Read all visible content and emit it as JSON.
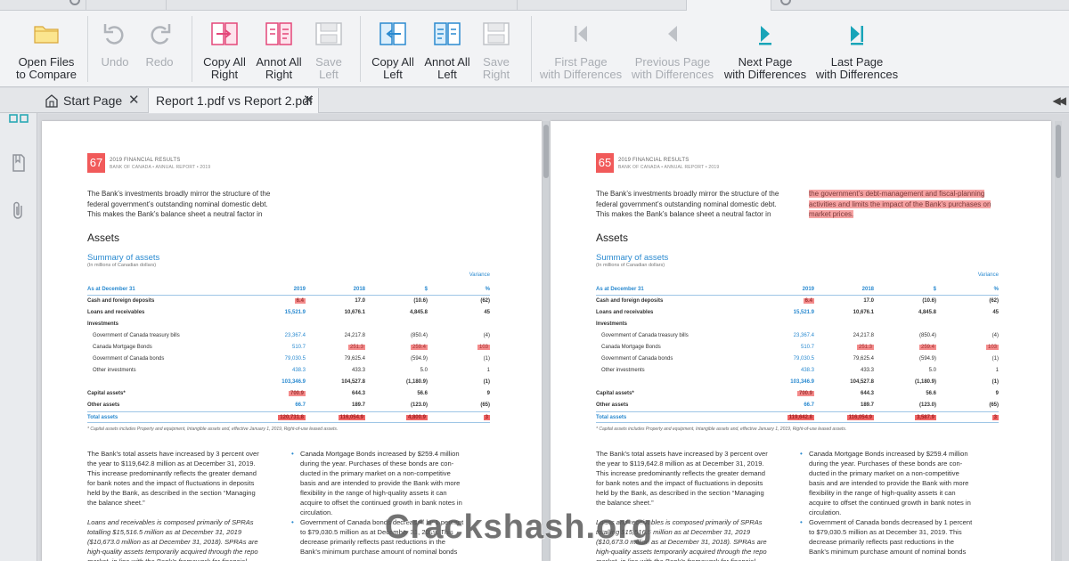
{
  "ribbon": {
    "buttons": [
      {
        "label": "Open Files\nto Compare",
        "icon": "folder-icon",
        "enabled": true
      },
      {
        "label": "Undo",
        "icon": "undo-icon",
        "enabled": false
      },
      {
        "label": "Redo",
        "icon": "redo-icon",
        "enabled": false
      },
      {
        "label": "Copy All\nRight",
        "icon": "copy-all-right-icon",
        "enabled": true
      },
      {
        "label": "Annot All\nRight",
        "icon": "annot-all-right-icon",
        "enabled": true
      },
      {
        "label": "Save\nLeft",
        "icon": "save-left-icon",
        "enabled": false
      },
      {
        "label": "Copy All\nLeft",
        "icon": "copy-all-left-icon",
        "enabled": true
      },
      {
        "label": "Annot All\nLeft",
        "icon": "annot-all-left-icon",
        "enabled": true
      },
      {
        "label": "Save\nRight",
        "icon": "save-right-icon",
        "enabled": false
      },
      {
        "label": "First Page\nwith Differences",
        "icon": "first-page-icon",
        "enabled": false
      },
      {
        "label": "Previous Page\nwith Differences",
        "icon": "previous-page-icon",
        "enabled": false
      },
      {
        "label": "Next Page\nwith Differences",
        "icon": "next-page-icon",
        "enabled": true
      },
      {
        "label": "Last Page\nwith Differences",
        "icon": "last-page-icon",
        "enabled": true
      }
    ]
  },
  "tabs": [
    {
      "label": "Start Page",
      "icon": "home-icon",
      "close": "✕"
    },
    {
      "label": "Report 1.pdf vs Report 2.pdf",
      "close": "✕"
    }
  ],
  "sidebar": {
    "icons": [
      "thumbnails-icon",
      "bookmark-icon",
      "attachment-icon"
    ]
  },
  "colors": {
    "accent_red": "#f15a5a",
    "diff_highlight": "#f48b8b",
    "link_blue": "#2a8ad0",
    "teal": "#18a4b8"
  },
  "pages": {
    "left": {
      "page_number": "67",
      "header_title": "2019 FINANCIAL RESULTS",
      "header_sub": "BANK OF CANADA • ANNUAL REPORT • 2019",
      "intro": [
        "The Bank’s investments broadly mirror the structure of the",
        "federal government’s outstanding nominal domestic debt.",
        "This makes the Bank’s balance sheet a neutral factor in"
      ],
      "heading": "Assets",
      "summary_title": "Summary of assets",
      "summary_sub": "(In millions of Canadian dollars)",
      "variance_label": "Variance",
      "table_header": [
        "As at December 31",
        "2019",
        "2018",
        "$",
        "%"
      ],
      "rows": [
        {
          "label": "Cash and foreign deposits",
          "v2019": "6.4",
          "v2018": "17.0",
          "d": "(10.6)",
          "p": "(62)",
          "style": "bold"
        },
        {
          "label": "Loans and receivables",
          "v2019": "15,521.9",
          "v2018": "10,676.1",
          "d": "4,845.8",
          "p": "45",
          "style": "bold"
        },
        {
          "label": "Investments",
          "v2019": "",
          "v2018": "",
          "d": "",
          "p": "",
          "style": "bold"
        },
        {
          "label": "Government of Canada treasury bills",
          "v2019": "23,367.4",
          "v2018": "24,217.8",
          "d": "(850.4)",
          "p": "(4)",
          "style": "indent"
        },
        {
          "label": "Canada Mortgage Bonds",
          "v2019": "510.7",
          "v2018": "251.3",
          "d": "259.4",
          "p": "103",
          "style": "indent"
        },
        {
          "label": "Government of Canada bonds",
          "v2019": "79,030.5",
          "v2018": "79,625.4",
          "d": "(594.9)",
          "p": "(1)",
          "style": "indent"
        },
        {
          "label": "Other investments",
          "v2019": "438.3",
          "v2018": "433.3",
          "d": "5.0",
          "p": "1",
          "style": "indent"
        },
        {
          "label": "",
          "v2019": "103,346.9",
          "v2018": "104,527.8",
          "d": "(1,180.9)",
          "p": "(1)",
          "style": "bold"
        },
        {
          "label": "Capital assets*",
          "v2019": "700.9",
          "v2018": "644.3",
          "d": "56.6",
          "p": "9",
          "style": "bold"
        },
        {
          "label": "Other assets",
          "v2019": "66.7",
          "v2018": "189.7",
          "d": "(123.0)",
          "p": "(65)",
          "style": "bold"
        },
        {
          "label": "Total assets",
          "v2019": "120,731.8",
          "v2018": "116,054.9",
          "d": "4,800.9",
          "p": "3",
          "style": "total"
        }
      ],
      "footnote": "* Capital assets includes Property and equipment, Intangible assets and, effective January 1, 2019, Right-of-use leased assets.",
      "body_left": [
        "The Bank’s total assets have increased by 3 percent over",
        "the year to $119,642.8 million as at December 31, 2019.",
        "This increase predominantly reflects the greater demand",
        "for bank notes and the impact of fluctuations in deposits",
        "held by the Bank, as described in the section “Managing",
        "the balance sheet.”",
        "",
        "Loans and receivables is composed primarily of SPRAs",
        "totalling $15,516.5 million as at December 31, 2019",
        "($10,673.0 million as at December 31, 2018). SPRAs are",
        "high-quality assets temporarily acquired through the repo",
        "market, in line with the Bank’s framework for financial"
      ],
      "body_right": [
        "Canada Mortgage Bonds increased by $259.4 million",
        "during the year. Purchases of these bonds are con-",
        "ducted in the primary market on a non-competitive",
        "basis and are intended to provide the Bank with more",
        "flexibility in the range of high-quality assets it can",
        "acquire to offset the continued growth in bank notes in",
        "circulation.",
        "Government of Canada bonds decreased by 1 percent",
        "to $79,030.5 million as at December 31, 2019. This",
        "decrease primarily reflects past reductions in the",
        "Bank’s minimum purchase amount of nominal bonds"
      ]
    },
    "right": {
      "page_number": "65",
      "header_title": "2019 FINANCIAL RESULTS",
      "header_sub": "BANK OF CANADA • ANNUAL REPORT • 2019",
      "intro": [
        "The Bank’s investments broadly mirror the structure of the",
        "federal government’s outstanding nominal domestic debt.",
        "This makes the Bank’s balance sheet a neutral factor in"
      ],
      "intro_highlight": [
        "the government’s debt-management and fiscal-planning",
        "activities and limits the impact of the Bank’s purchases on",
        "market prices."
      ],
      "heading": "Assets",
      "summary_title": "Summary of assets",
      "summary_sub": "(In millions of Canadian dollars)",
      "variance_label": "Variance",
      "table_header": [
        "As at December 31",
        "2019",
        "2018",
        "$",
        "%"
      ],
      "rows": [
        {
          "label": "Cash and foreign deposits",
          "v2019": "6.4",
          "v2018": "17.0",
          "d": "(10.6)",
          "p": "(62)",
          "style": "bold"
        },
        {
          "label": "Loans and receivables",
          "v2019": "15,521.9",
          "v2018": "10,676.1",
          "d": "4,845.8",
          "p": "45",
          "style": "bold"
        },
        {
          "label": "Investments",
          "v2019": "",
          "v2018": "",
          "d": "",
          "p": "",
          "style": "bold"
        },
        {
          "label": "Government of Canada treasury bills",
          "v2019": "23,367.4",
          "v2018": "24,217.8",
          "d": "(850.4)",
          "p": "(4)",
          "style": "indent"
        },
        {
          "label": "Canada Mortgage Bonds",
          "v2019": "510.7",
          "v2018": "251.3",
          "d": "259.4",
          "p": "103",
          "style": "indent"
        },
        {
          "label": "Government of Canada bonds",
          "v2019": "79,030.5",
          "v2018": "79,625.4",
          "d": "(594.9)",
          "p": "(1)",
          "style": "indent"
        },
        {
          "label": "Other investments",
          "v2019": "438.3",
          "v2018": "433.3",
          "d": "5.0",
          "p": "1",
          "style": "indent"
        },
        {
          "label": "",
          "v2019": "103,346.9",
          "v2018": "104,527.8",
          "d": "(1,180.9)",
          "p": "(1)",
          "style": "bold"
        },
        {
          "label": "Capital assets*",
          "v2019": "700.9",
          "v2018": "644.3",
          "d": "56.6",
          "p": "9",
          "style": "bold"
        },
        {
          "label": "Other assets",
          "v2019": "66.7",
          "v2018": "189.7",
          "d": "(123.0)",
          "p": "(65)",
          "style": "bold"
        },
        {
          "label": "Total assets",
          "v2019": "119,642.8",
          "v2018": "116,054.9",
          "d": "3,587.9",
          "p": "3",
          "style": "total"
        }
      ],
      "footnote": "* Capital assets includes Property and equipment, Intangible assets and, effective January 1, 2019, Right-of-use leased assets.",
      "body_left": [
        "The Bank’s total assets have increased by 3 percent over",
        "the year to $119,642.8 million as at December 31, 2019.",
        "This increase predominantly reflects the greater demand",
        "for bank notes and the impact of fluctuations in deposits",
        "held by the Bank, as described in the section “Managing",
        "the balance sheet.”",
        "",
        "Loans and receivables is composed primarily of SPRAs",
        "totalling $15,516.5 million as at December 31, 2019",
        "($10,673.0 million as at December 31, 2018). SPRAs are",
        "high-quality assets temporarily acquired through the repo",
        "market, in line with the Bank’s framework for financial"
      ],
      "body_right": [
        "Canada Mortgage Bonds increased by $259.4 million",
        "during the year. Purchases of these bonds are con-",
        "ducted in the primary market on a non-competitive",
        "basis and are intended to provide the Bank with more",
        "flexibility in the range of high-quality assets it can",
        "acquire to offset the continued growth in bank notes in",
        "circulation.",
        "Government of Canada bonds decreased by 1 percent",
        "to $79,030.5 million as at December 31, 2019. This",
        "decrease primarily reflects past reductions in the",
        "Bank’s minimum purchase amount of nominal bonds"
      ]
    }
  },
  "watermark": "Crackshash.org"
}
